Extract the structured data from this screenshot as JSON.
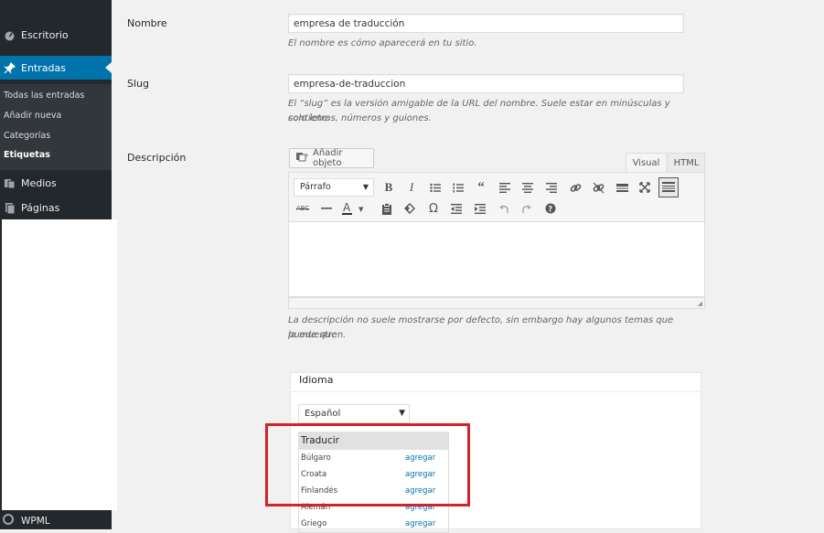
{
  "sidebar": {
    "items": [
      {
        "label": "Escritorio",
        "icon": "dashboard-icon"
      },
      {
        "label": "Entradas",
        "icon": "pin-icon",
        "active": true
      },
      {
        "label": "Medios",
        "icon": "media-icon"
      },
      {
        "label": "Páginas",
        "icon": "pages-icon"
      }
    ],
    "submenu": [
      "Todas las entradas",
      "Añadir nueva",
      "Categorías",
      "Etiquetas"
    ],
    "bottom_item": {
      "label": "WPML",
      "icon": "wpml-icon"
    },
    "colors": {
      "bg": "#23282d",
      "active": "#0073aa"
    }
  },
  "form": {
    "name": {
      "label": "Nombre",
      "value": "empresa de traducción",
      "help": "El nombre es cómo aparecerá en tu sitio."
    },
    "slug": {
      "label": "Slug",
      "value": "empresa-de-traduccion",
      "help_line1": "El “slug” es la versión amigable de la URL del nombre. Suele estar en minúsculas y contiene",
      "help_line2": "solo letras, números y guiones."
    },
    "description": {
      "label": "Descripción",
      "help_line1": "La descripción no suele mostrarse por defecto, sin embargo hay algunos temas que puede que",
      "help_line2": "la muestren."
    }
  },
  "editor": {
    "add_media_label": "Añadir objeto",
    "tabs": [
      "Visual",
      "HTML"
    ],
    "format_value": "Párrafo"
  },
  "language": {
    "title": "Idioma",
    "selected": "Español",
    "translate_header": "Traducir",
    "rows": [
      {
        "lang": "Búlgaro",
        "action": "agregar"
      },
      {
        "lang": "Croata",
        "action": "agregar"
      },
      {
        "lang": "Finlandés",
        "action": "agregar"
      },
      {
        "lang": "Alemán",
        "action": "agregar"
      },
      {
        "lang": "Griego",
        "action": "agregar"
      }
    ],
    "highlight_color": "#d3222a"
  }
}
